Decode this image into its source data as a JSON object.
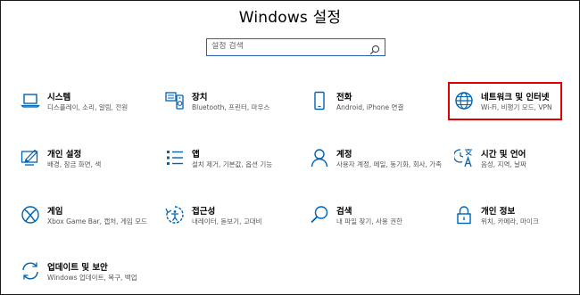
{
  "window": {
    "title": "Windows 설정"
  },
  "search": {
    "placeholder": "설정 검색"
  },
  "tiles": [
    {
      "id": "system",
      "title": "시스템",
      "desc": "디스플레이, 소리, 알림, 전원",
      "icon": "laptop-icon"
    },
    {
      "id": "devices",
      "title": "장치",
      "desc": "Bluetooth, 프린터, 마우스",
      "icon": "keyboard-speaker-icon"
    },
    {
      "id": "phone",
      "title": "전화",
      "desc": "Android, iPhone 연결",
      "icon": "phone-icon"
    },
    {
      "id": "network",
      "title": "네트워크 및 인터넷",
      "desc": "Wi-Fi, 비행기 모드, VPN",
      "icon": "globe-icon"
    },
    {
      "id": "personalization",
      "title": "개인 설정",
      "desc": "배경, 잠금 화면, 색",
      "icon": "paint-monitor-icon"
    },
    {
      "id": "apps",
      "title": "앱",
      "desc": "설치 제거, 기본값, 옵션 기능",
      "icon": "apps-list-icon"
    },
    {
      "id": "accounts",
      "title": "계정",
      "desc": "사용자 계정, 메일, 동기화, 회사, 가족",
      "icon": "person-icon"
    },
    {
      "id": "time-language",
      "title": "시간 및 언어",
      "desc": "음성, 지역, 날짜",
      "icon": "language-time-icon"
    },
    {
      "id": "gaming",
      "title": "게임",
      "desc": "Xbox Game Bar, 캡처, 게임 모드",
      "icon": "xbox-icon"
    },
    {
      "id": "ease-of-access",
      "title": "접근성",
      "desc": "내레이터, 돋보기, 고대비",
      "icon": "ease-of-access-icon"
    },
    {
      "id": "search",
      "title": "검색",
      "desc": "내 파일 찾기, 사용 권한",
      "icon": "magnifier-icon"
    },
    {
      "id": "privacy",
      "title": "개인 정보",
      "desc": "위치, 카메라, 마이크",
      "icon": "lock-icon"
    },
    {
      "id": "update-security",
      "title": "업데이트 및 보안",
      "desc": "Windows 업데이트, 복구, 백업",
      "icon": "sync-icon"
    }
  ],
  "colors": {
    "accent": "#0063b1",
    "search_border": "#2b5fb5",
    "highlight": "#e00000"
  }
}
